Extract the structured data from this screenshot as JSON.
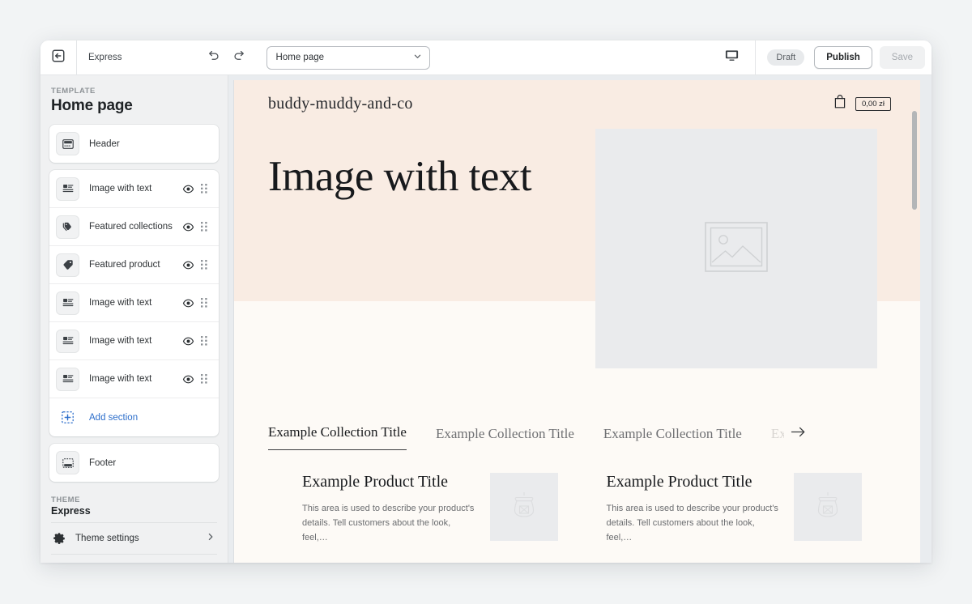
{
  "topbar": {
    "exit_icon": "exit-arrow-icon",
    "theme_label": "Express",
    "undo_icon": "undo-icon",
    "redo_icon": "redo-icon",
    "page_selector": {
      "value": "Home page",
      "chevron_icon": "chevron-down-icon"
    },
    "device_icon": "desktop-icon",
    "draft_badge": "Draft",
    "publish_label": "Publish",
    "save_label": "Save"
  },
  "sidebar": {
    "template_label": "TEMPLATE",
    "template_title": "Home page",
    "header_group": [
      {
        "label": "Header",
        "icon": "header-section-icon",
        "has_controls": false
      }
    ],
    "sections": [
      {
        "label": "Image with text",
        "icon": "image-with-text-icon",
        "has_controls": true
      },
      {
        "label": "Featured collections",
        "icon": "featured-collections-icon",
        "has_controls": true
      },
      {
        "label": "Featured product",
        "icon": "featured-product-tag-icon",
        "has_controls": true
      },
      {
        "label": "Image with text",
        "icon": "image-with-text-icon",
        "has_controls": true
      },
      {
        "label": "Image with text",
        "icon": "image-with-text-icon",
        "has_controls": true
      },
      {
        "label": "Image with text",
        "icon": "image-with-text-icon",
        "has_controls": true
      }
    ],
    "add_section": {
      "label": "Add section",
      "icon": "add-section-icon"
    },
    "footer_group": [
      {
        "label": "Footer",
        "icon": "footer-section-icon",
        "has_controls": false
      }
    ],
    "theme_label": "THEME",
    "theme_name": "Express",
    "theme_rows": [
      {
        "label": "Theme settings",
        "icon": "gear-icon",
        "chevron": "chevron-right-icon"
      }
    ],
    "eye_icon": "eye-visible-icon",
    "grip_icon": "drag-handle-icon"
  },
  "preview": {
    "store_name": "buddy-muddy-and-co",
    "cart_icon": "shopping-bag-icon",
    "cart_total": "0,00 zł",
    "hero": {
      "heading": "Image with text",
      "image_placeholder_icon": "image-placeholder-icon"
    },
    "collection_tabs": [
      {
        "label": "Example Collection Title",
        "active": true
      },
      {
        "label": "Example Collection Title",
        "active": false
      },
      {
        "label": "Example Collection Title",
        "active": false
      },
      {
        "label": "Ex",
        "active": false,
        "faded": true
      }
    ],
    "tabs_next_icon": "arrow-right-icon",
    "products": [
      {
        "title": "Example Product Title",
        "description": "This area is used to describe your product's details. Tell customers about the look, feel,…",
        "image_icon": "product-placeholder-icon"
      },
      {
        "title": "Example Product Title",
        "description": "This area is used to describe your product's details. Tell customers about the look, feel,…",
        "image_icon": "product-placeholder-icon"
      }
    ]
  },
  "colors": {
    "accent_link": "#2c6ecb",
    "hero_band": "#f9ece3",
    "page_cream": "#fdfaf6",
    "placeholder_gray": "#eaebed"
  }
}
